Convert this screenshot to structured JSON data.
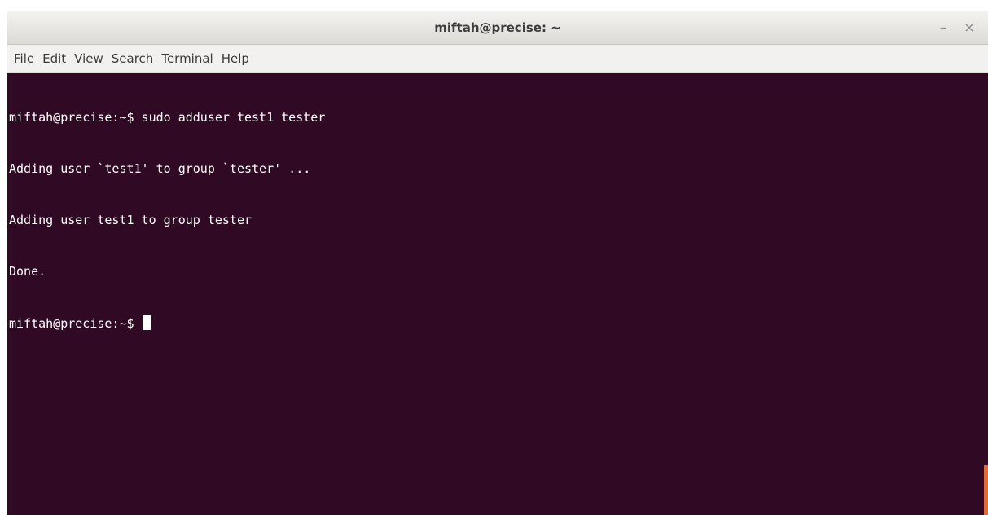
{
  "window": {
    "title": "miftah@precise: ~",
    "minimize_glyph": "–",
    "close_glyph": "×"
  },
  "menu": {
    "items": [
      "File",
      "Edit",
      "View",
      "Search",
      "Terminal",
      "Help"
    ]
  },
  "terminal": {
    "lines": [
      "miftah@precise:~$ sudo adduser test1 tester",
      "Adding user `test1' to group `tester' ...",
      "Adding user test1 to group tester",
      "Done."
    ],
    "prompt": "miftah@precise:~$ "
  },
  "colors": {
    "terminal_bg": "#300a24",
    "terminal_fg": "#ffffff",
    "scroll_accent": "#e46a33"
  }
}
